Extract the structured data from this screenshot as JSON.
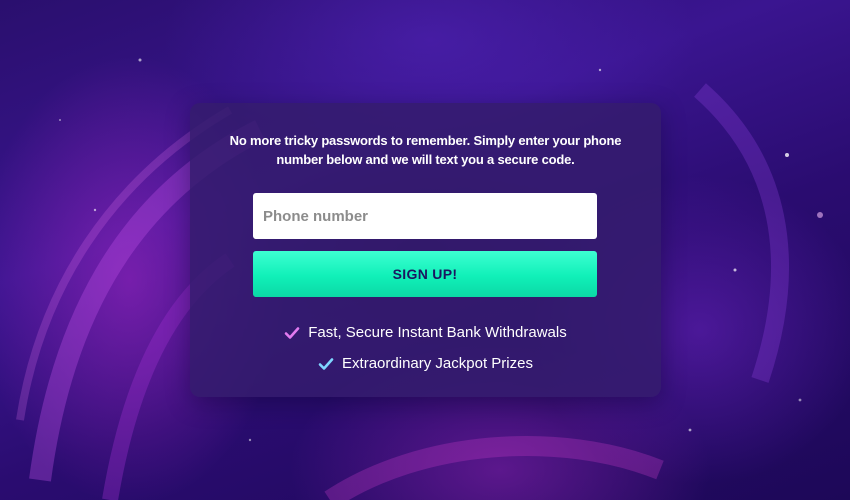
{
  "signup": {
    "intro_text": "No more tricky passwords to remember. Simply enter your phone number below and we will text you a secure code.",
    "phone_placeholder": "Phone number",
    "button_label": "SIGN UP!"
  },
  "features": [
    {
      "label": "Fast, Secure Instant Bank Withdrawals",
      "icon": "checkmark-icon",
      "color": "#e27bf0"
    },
    {
      "label": "Extraordinary Jackpot Prizes",
      "icon": "checkmark-icon",
      "color": "#7fd6ff"
    }
  ],
  "colors": {
    "button": "#19f5c0",
    "button_text": "#1b1560",
    "card": "#341c6e"
  }
}
